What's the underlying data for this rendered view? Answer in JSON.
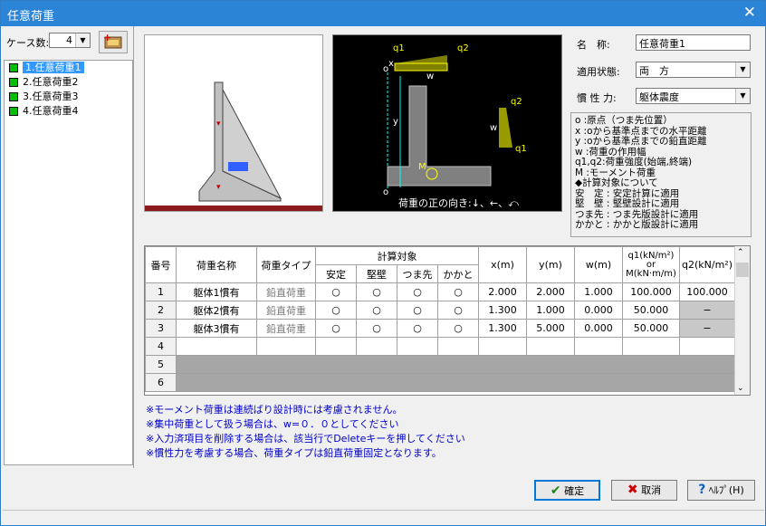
{
  "window": {
    "title": "任意荷重"
  },
  "left": {
    "case_count_label": "ケース数:",
    "case_count_value": "4",
    "cases": [
      {
        "label": "1.任意荷重1",
        "selected": true
      },
      {
        "label": "2.任意荷重2"
      },
      {
        "label": "3.任意荷重3"
      },
      {
        "label": "4.任意荷重4"
      }
    ]
  },
  "diagram": {
    "q1a": "q1",
    "q2a": "q2",
    "x": "x",
    "o_top": "o",
    "y": "y",
    "w_top": "w",
    "q2b": "q2",
    "q1b": "q1",
    "w_side": "w",
    "M": "M",
    "o_bottom": "o",
    "direction_label": "荷重の正の向き:↓、←、⤺"
  },
  "form": {
    "name_label": "名　称:",
    "name_value": "任意荷重1",
    "state_label": "適用状態:",
    "state_value": "両　方",
    "inertia_label": "慣 性 力:",
    "inertia_value": "躯体震度"
  },
  "legend": [
    "o :原点（つま先位置）",
    "x :oから基準点までの水平距離",
    "y :oから基準点までの鉛直距離",
    "w :荷重の作用幅",
    "q1,q2:荷重強度(始端,終端)",
    "M :モーメント荷重",
    "◆計算対象について",
    "安　定 : 安定計算に適用",
    "堅　壁 : 堅壁設計に適用",
    "つま先 : つま先版設計に適用",
    "かかと : かかと版設計に適用"
  ],
  "table": {
    "headers": {
      "no": "番号",
      "name": "荷重名称",
      "type": "荷重タイプ",
      "target": "計算対象",
      "stab": "安定",
      "wall": "堅壁",
      "toe": "つま先",
      "heel": "かかと",
      "x": "x(m)",
      "y": "y(m)",
      "w": "w(m)",
      "q1a": "q1(kN/m²)",
      "q1b": "or",
      "q1c": "M(kN·m/m)",
      "q2": "q2(kN/m²)"
    },
    "rows": [
      {
        "no": "1",
        "name": "躯体1慣有",
        "type": "鉛直荷重",
        "s": "○",
        "w2": "○",
        "t": "○",
        "h": "○",
        "x": "2.000",
        "y": "2.000",
        "wv": "1.000",
        "q1": "100.000",
        "q2": "100.000"
      },
      {
        "no": "2",
        "name": "躯体2慣有",
        "type": "鉛直荷重",
        "s": "○",
        "w2": "○",
        "t": "○",
        "h": "○",
        "x": "1.300",
        "y": "1.000",
        "wv": "0.000",
        "q1": "50.000",
        "q2": "−"
      },
      {
        "no": "3",
        "name": "躯体3慣有",
        "type": "鉛直荷重",
        "s": "○",
        "w2": "○",
        "t": "○",
        "h": "○",
        "x": "1.300",
        "y": "5.000",
        "wv": "0.000",
        "q1": "50.000",
        "q2": "−"
      },
      {
        "no": "4"
      },
      {
        "no": "5"
      },
      {
        "no": "6"
      }
    ]
  },
  "notes": [
    "※モーメント荷重は連続ばり設計時には考慮されません。",
    "※集中荷重として扱う場合は、w=０．０としてください",
    "※入力済項目を削除する場合は、該当行でDeleteキーを押してください",
    "※慣性力を考慮する場合、荷重タイプは鉛直荷重固定となります。"
  ],
  "buttons": {
    "ok": "確定",
    "cancel": "取消",
    "help": "ﾍﾙﾌﾟ(H)"
  },
  "colors": {
    "titlebar": "#2b84d6",
    "selection": "#3399ff",
    "case_marker": "#00c000",
    "load_fill": "#ffff00",
    "diagram_line": "#00ffff",
    "note_text": "#0000cc"
  }
}
